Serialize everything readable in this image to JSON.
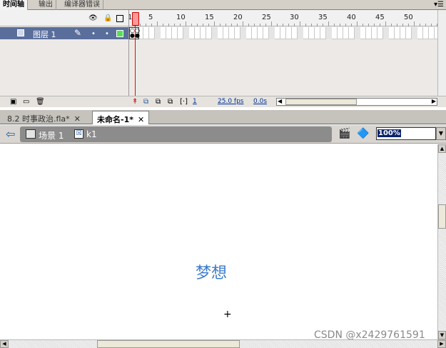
{
  "panel_tabs": [
    {
      "label": "时间轴",
      "active": true
    },
    {
      "label": "输出",
      "active": false
    },
    {
      "label": "编译器错误",
      "active": false
    }
  ],
  "panel_menu_icon": "panel-menu-icon",
  "timeline": {
    "header_icons": [
      "eye-icon",
      "lock-icon",
      "outline-icon"
    ],
    "frame_numbers": [
      "5",
      "10",
      "15",
      "20",
      "25",
      "30",
      "35",
      "40",
      "45",
      "50"
    ],
    "ruler_first_mark": "1",
    "layer": {
      "name": "图层 1"
    },
    "footer": {
      "current_frame": "1",
      "fps": "25.0 fps",
      "time": "0.0s"
    }
  },
  "doc_tabs": [
    {
      "label": "8.2 时事政治.fla*",
      "active": false
    },
    {
      "label": "未命名-1*",
      "active": true
    }
  ],
  "editbar": {
    "scene_label": "场景 1",
    "symbol_label": "k1",
    "zoom_value": "100%"
  },
  "stage": {
    "text": "梦想",
    "registration_mark": "+"
  },
  "watermark": "CSDN @x2429761591"
}
